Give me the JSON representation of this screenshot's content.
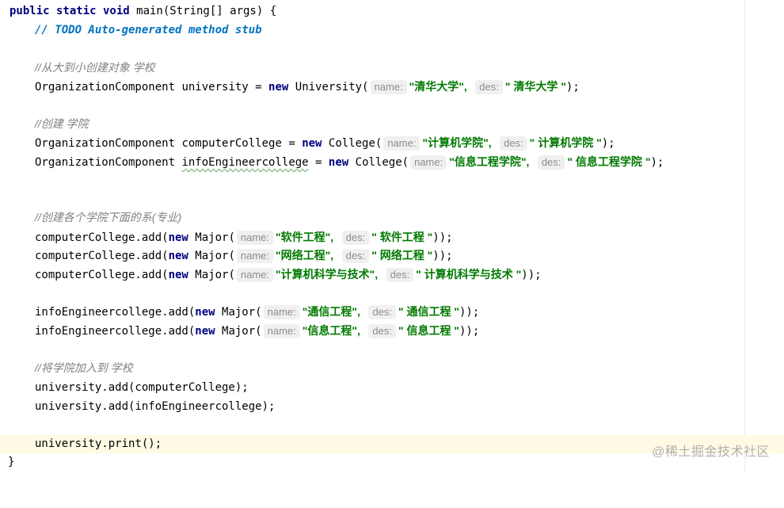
{
  "code": {
    "sig_kw": "public static void",
    "sig_rest": " main(String[] args) {",
    "todo_comment": "// TODO Auto-generated method stub",
    "c_university": "//从大到小创建对象 学校",
    "oc_type": "OrganizationComponent",
    "eq_new": "=",
    "new_kw": "new",
    "university_var": " university ",
    "university_cls": " University(",
    "uni_name": "\"清华大学\",",
    "uni_des": "\" 清华大学 \"",
    "close_stmt": ");",
    "c_college": "//创建 学院",
    "cc_var": " computerCollege ",
    "ie_var_pre": " ",
    "ie_var": "infoEngineercollege",
    "college_cls": " College(",
    "cc_name": "\"计算机学院\",",
    "cc_des": "\" 计算机学院 \"",
    "ie_name": "\"信息工程学院\",",
    "ie_des": "\" 信息工程学院 \"",
    "c_major": "//创建各个学院下面的系(专业)",
    "cc_add": "computerCollege.add(",
    "ie_add": "infoEngineercollege.add(",
    "major_cls": " Major(",
    "m1_name": "\"软件工程\",",
    "m1_des": "\" 软件工程 \"",
    "m2_name": "\"网络工程\",",
    "m2_des": "\" 网络工程 \"",
    "m3_name": "\"计算机科学与技术\",",
    "m3_des": "\" 计算机科学与技术 \"",
    "m4_name": "\"通信工程\",",
    "m4_des": "\" 通信工程 \"",
    "m5_name": "\"信息工程\",",
    "m5_des": "\" 信息工程 \"",
    "close_add": "));",
    "c_join": "//将学院加入到 学校",
    "uni_add_cc": "university.add(computerCollege);",
    "uni_add_ie": "university.add(infoEngineercollege);",
    "uni_print": "university.print();",
    "close_brace": "}"
  },
  "hints": {
    "name": "name:",
    "des": "des:"
  },
  "watermark": "@稀土掘金技术社区",
  "colors": {
    "keyword": "#000080",
    "string": "#007a00",
    "todo": "#0073bf",
    "comment": "#808080",
    "current_line": "#fffae3"
  }
}
